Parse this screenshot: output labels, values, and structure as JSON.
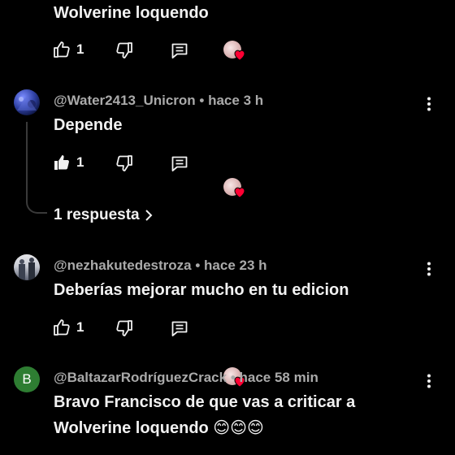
{
  "comments": [
    {
      "text": "Wolverine loquendo",
      "likes": "1"
    },
    {
      "author": "@Water2413_Unicron",
      "time": "hace 3 h",
      "text": "Depende",
      "likes": "1",
      "replies_label": "1 respuesta"
    },
    {
      "author": "@nezhakutedestroza",
      "time": "hace 23 h",
      "text": "Deberías mejorar mucho en tu edicion",
      "likes": "1"
    },
    {
      "author": "@BaltazarRodríguezCrack",
      "time": "hace 58 min",
      "avatar_letter": "B",
      "text_line1": "Bravo Francisco de que vas a criticar a",
      "text_line2": "Wolverine loquendo 😊😊😊"
    }
  ],
  "separator": " • ",
  "colors": {
    "background": "#000000",
    "text": "#f1f1f1",
    "meta": "#aaaaaa",
    "heart": "#ff0033",
    "avatar_b": "#2e7d32"
  },
  "icons": [
    "thumb-up-icon",
    "thumb-down-icon",
    "reply-icon",
    "creator-heart-icon",
    "more-vert-icon",
    "chevron-right-icon"
  ]
}
